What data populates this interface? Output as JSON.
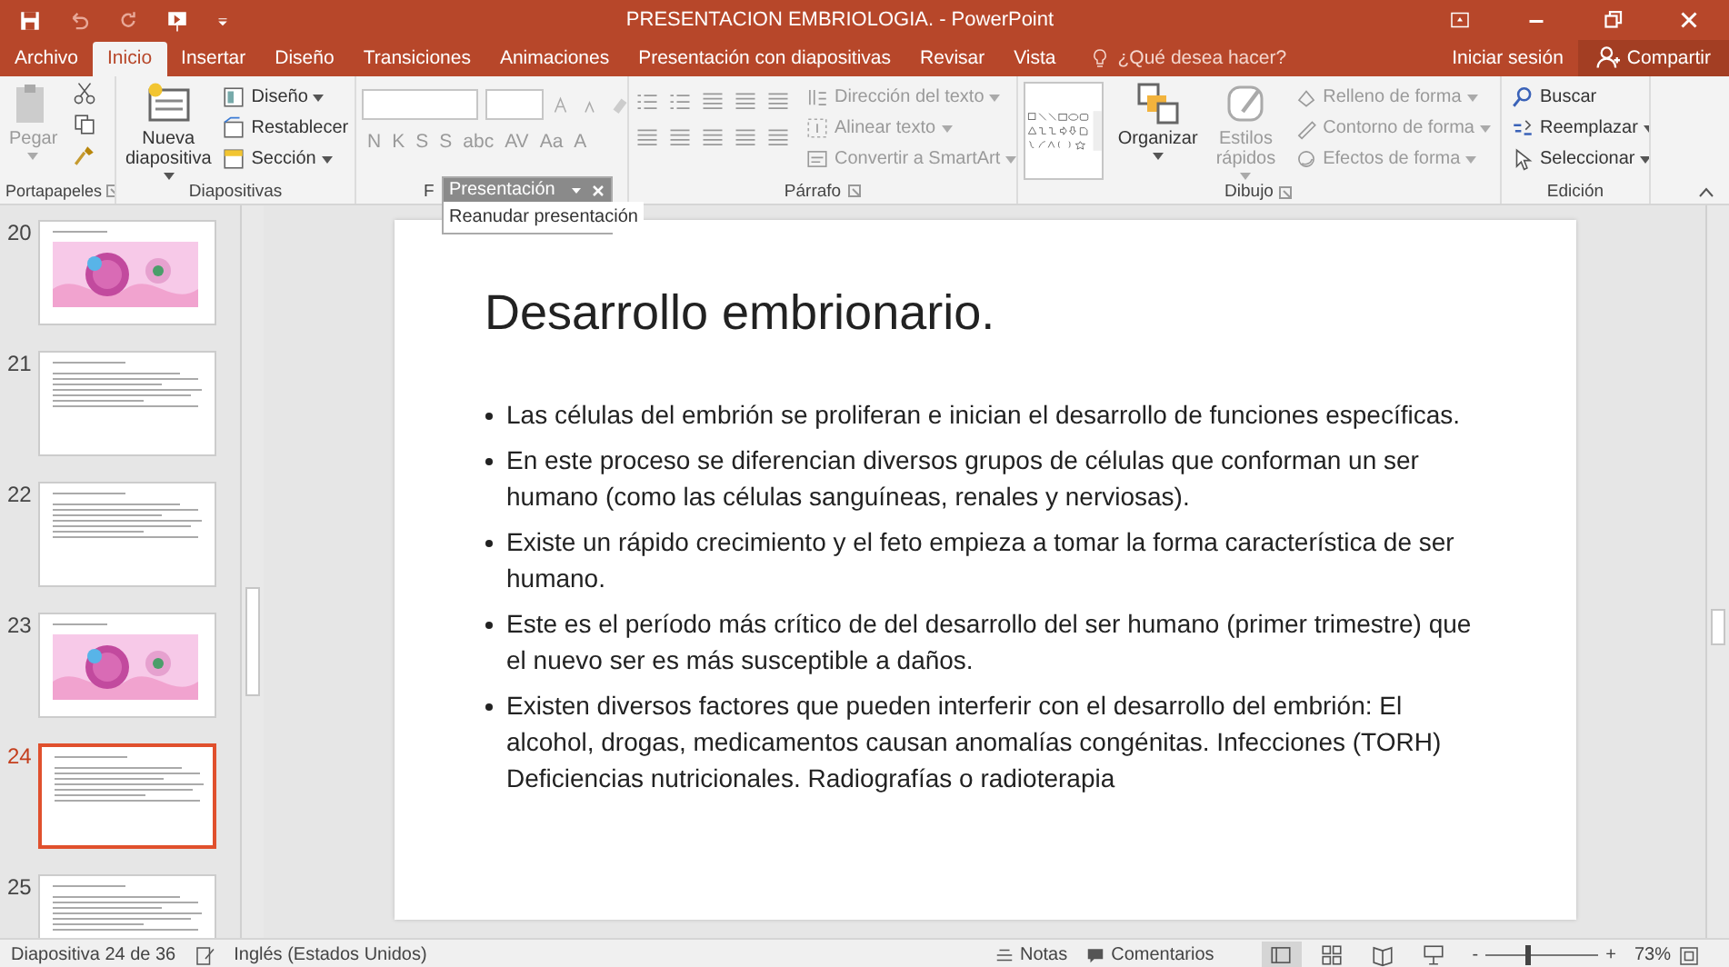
{
  "window": {
    "title": "PRESENTACION EMBRIOLOGIA. - PowerPoint"
  },
  "tabs": [
    {
      "label": "Archivo",
      "selected": false
    },
    {
      "label": "Inicio",
      "selected": true
    },
    {
      "label": "Insertar",
      "selected": false
    },
    {
      "label": "Diseño",
      "selected": false
    },
    {
      "label": "Transiciones",
      "selected": false
    },
    {
      "label": "Animaciones",
      "selected": false
    },
    {
      "label": "Presentación con diapositivas",
      "selected": false
    },
    {
      "label": "Revisar",
      "selected": false
    },
    {
      "label": "Vista",
      "selected": false
    }
  ],
  "tell_me": {
    "placeholder": "¿Qué desea hacer?"
  },
  "account": {
    "sign_in": "Iniciar sesión",
    "share": "Compartir"
  },
  "ribbon": {
    "groups": [
      {
        "kind": "clipboard",
        "label": "Portapapeles",
        "buttons": [
          {
            "kind": "large",
            "label": "Pegar",
            "disabled": true,
            "dropdown": true
          }
        ]
      },
      {
        "kind": "slides",
        "label": "Diapositivas",
        "buttons": [
          {
            "kind": "large",
            "label": "Nueva diapositiva",
            "disabled": false,
            "dropdown": true
          },
          {
            "kind": "small",
            "label": "Diseño",
            "disabled": false,
            "dropdown": true
          },
          {
            "kind": "small",
            "label": "Restablecer",
            "disabled": false,
            "dropdown": false
          },
          {
            "kind": "small",
            "label": "Sección",
            "disabled": false,
            "dropdown": true
          }
        ]
      },
      {
        "kind": "font",
        "label": "F",
        "buttons": [
          {
            "kind": "glyph",
            "label": "N",
            "disabled": true
          },
          {
            "kind": "glyph",
            "label": "K",
            "disabled": true
          },
          {
            "kind": "glyph",
            "label": "S",
            "disabled": true
          },
          {
            "kind": "glyph",
            "label": "S",
            "disabled": true
          },
          {
            "kind": "glyph",
            "label": "abc",
            "disabled": true
          },
          {
            "kind": "glyph",
            "label": "AV",
            "disabled": true
          },
          {
            "kind": "glyph",
            "label": "Aa",
            "disabled": true
          },
          {
            "kind": "glyph",
            "label": "A",
            "disabled": true
          }
        ]
      },
      {
        "kind": "paragraph",
        "label": "Párrafo",
        "buttons": [
          {
            "kind": "small",
            "label": "Dirección del texto",
            "disabled": true,
            "dropdown": true
          },
          {
            "kind": "small",
            "label": "Alinear texto",
            "disabled": true,
            "dropdown": true
          },
          {
            "kind": "small",
            "label": "Convertir a SmartArt",
            "disabled": true,
            "dropdown": true
          }
        ]
      },
      {
        "kind": "drawing",
        "label": "Dibujo",
        "buttons": [
          {
            "kind": "large",
            "label": "Organizar",
            "disabled": false,
            "dropdown": true
          },
          {
            "kind": "large",
            "label": "Estilos rápidos",
            "disabled": true,
            "dropdown": true
          },
          {
            "kind": "small",
            "label": "Relleno de forma",
            "disabled": true,
            "dropdown": true
          },
          {
            "kind": "small",
            "label": "Contorno de forma",
            "disabled": true,
            "dropdown": true
          },
          {
            "kind": "small",
            "label": "Efectos de forma",
            "disabled": true,
            "dropdown": true
          }
        ]
      },
      {
        "kind": "editing",
        "label": "Edición",
        "buttons": [
          {
            "kind": "small",
            "label": "Buscar",
            "disabled": false,
            "dropdown": false
          },
          {
            "kind": "small",
            "label": "Reemplazar",
            "disabled": false,
            "dropdown": true
          },
          {
            "kind": "small",
            "label": "Seleccionar",
            "disabled": false,
            "dropdown": true
          }
        ]
      }
    ]
  },
  "floating_toolbar": {
    "title": "Presentación",
    "button": "Reanudar presentación"
  },
  "thumbnails": [
    {
      "number": "20",
      "kind": "picture",
      "selected": false
    },
    {
      "number": "21",
      "kind": "text",
      "selected": false
    },
    {
      "number": "22",
      "kind": "text",
      "selected": false
    },
    {
      "number": "23",
      "kind": "picture",
      "selected": false
    },
    {
      "number": "24",
      "kind": "text",
      "selected": true
    },
    {
      "number": "25",
      "kind": "text",
      "selected": false
    }
  ],
  "slide": {
    "title": "Desarrollo embrionario.",
    "bullets": [
      "Las células del embrión se proliferan e inician el desarrollo de funciones específicas.",
      "En este proceso se diferencian diversos grupos de células que conforman un ser humano (como las células sanguíneas, renales y nerviosas).",
      "Existe un rápido crecimiento y el feto empieza a tomar la forma característica de ser humano.",
      "Este es el período más crítico de del desarrollo del ser humano (primer trimestre) que el nuevo ser es más susceptible a daños.",
      "Existen diversos factores que pueden interferir con el desarrollo del embrión: El alcohol, drogas, medicamentos causan anomalías congénitas. Infecciones (TORH) Deficiencias nutricionales. Radiografías o radioterapia"
    ]
  },
  "status_bar": {
    "slide_counter": "Diapositiva 24 de 36",
    "language": "Inglés (Estados Unidos)",
    "notes": "Notas",
    "comments": "Comentarios",
    "views": [
      {
        "kind": "normal",
        "selected": true
      },
      {
        "kind": "sorter",
        "selected": false
      },
      {
        "kind": "reading",
        "selected": false
      },
      {
        "kind": "slideshow",
        "selected": false
      }
    ],
    "zoom": {
      "minus": "-",
      "plus": "+",
      "level": 0.36,
      "reading": "73%"
    }
  }
}
